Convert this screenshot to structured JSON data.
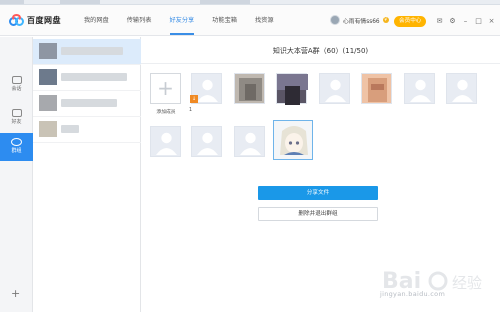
{
  "app": {
    "name": "百度网盘"
  },
  "nav": {
    "items": [
      "我的网盘",
      "传输列表",
      "好友分享",
      "功能宝箱",
      "找资源"
    ],
    "active_index": 2
  },
  "user": {
    "name": "心雨有情ss66",
    "vip_label": "会员中心"
  },
  "header_icons": [
    "mail-icon",
    "settings-icon",
    "minimize-icon",
    "maximize-icon",
    "close-icon"
  ],
  "rail": {
    "items": [
      {
        "label": "会话",
        "icon": "chat-icon"
      },
      {
        "label": "好友",
        "icon": "contact-icon"
      },
      {
        "label": "群组",
        "icon": "group-icon"
      }
    ],
    "active_index": 2,
    "add_icon": "plus-icon"
  },
  "group": {
    "title": "知识大本营A群（60）(11/50)",
    "add_member_label": "添加成员",
    "member_number_label": "1",
    "members_row1": [
      "default",
      "photo",
      "photo2",
      "default",
      "photo3",
      "default",
      "default"
    ],
    "members_row2": [
      "default",
      "default",
      "default",
      "anime"
    ]
  },
  "actions": {
    "share_label": "分享文件",
    "exit_label": "删除并退出群组"
  },
  "colors": {
    "accent": "#2d8cf0",
    "vip": "#ffb400",
    "share_button": "#1a98e8"
  },
  "watermark": {
    "text": "Bai 经验",
    "url": "jingyan.baidu.com"
  }
}
